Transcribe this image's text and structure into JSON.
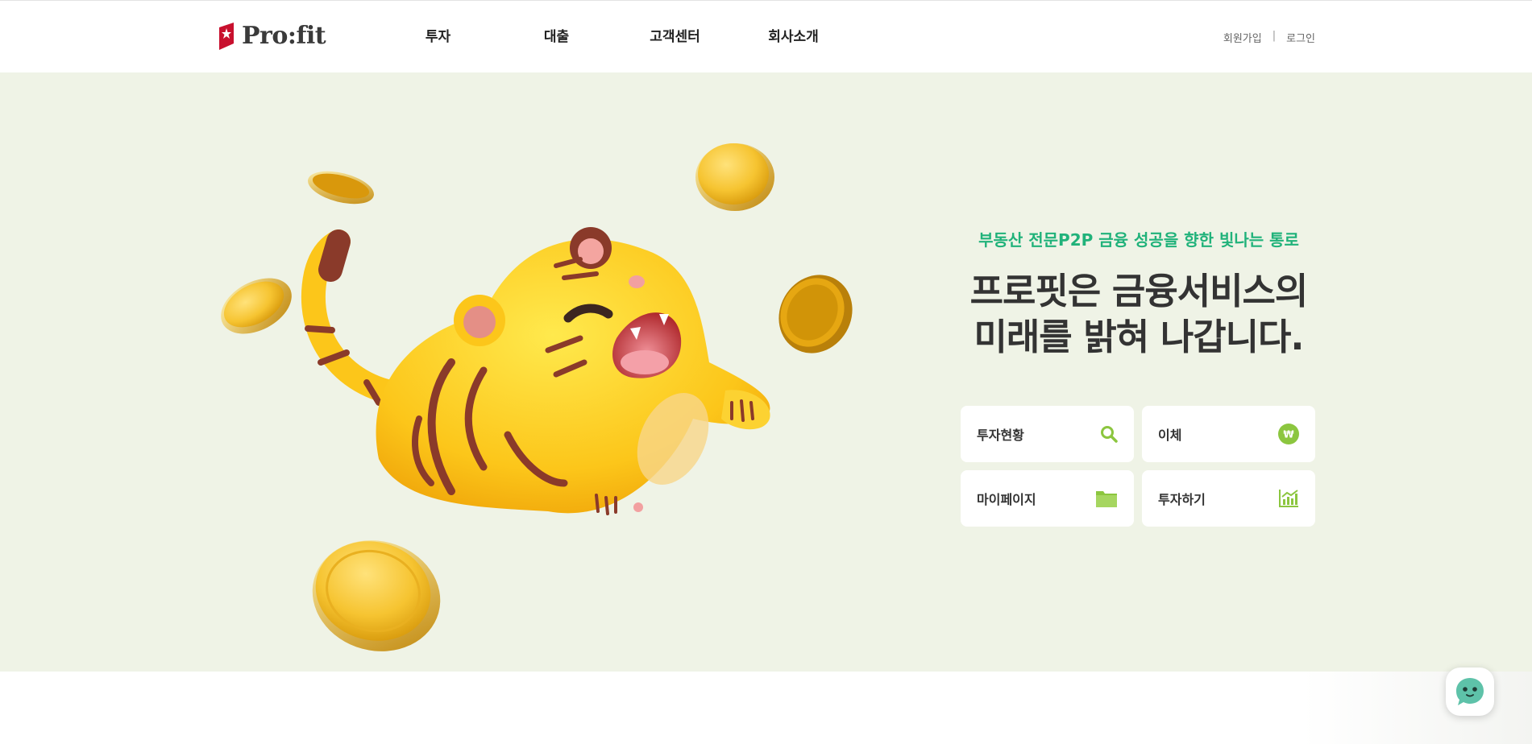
{
  "header": {
    "logo_text": "Pro:fit",
    "nav": [
      "투자",
      "대출",
      "고객센터",
      "회사소개"
    ],
    "signup": "회원가입",
    "separator": "|",
    "login": "로그인"
  },
  "hero": {
    "tagline": "부동산 전문P2P 금융 성공을 향한 빛나는 통로",
    "headline_line1": "프로핏은 금융서비스의",
    "headline_line2": "미래를 밝혀 나갑니다.",
    "quick_links": [
      {
        "label": "투자현황",
        "icon": "search-icon"
      },
      {
        "label": "이체",
        "icon": "won-icon"
      },
      {
        "label": "마이페이지",
        "icon": "folder-icon"
      },
      {
        "label": "투자하기",
        "icon": "chart-icon"
      }
    ],
    "illustration": "tiger-with-coins"
  },
  "chat": {
    "icon": "chat-bot-icon"
  },
  "colors": {
    "hero_bg": "#eff3e6",
    "accent_green": "#20b27a",
    "icon_green": "#8cc63f",
    "logo_red": "#c8102e",
    "coin_gold": "#f5c518"
  }
}
